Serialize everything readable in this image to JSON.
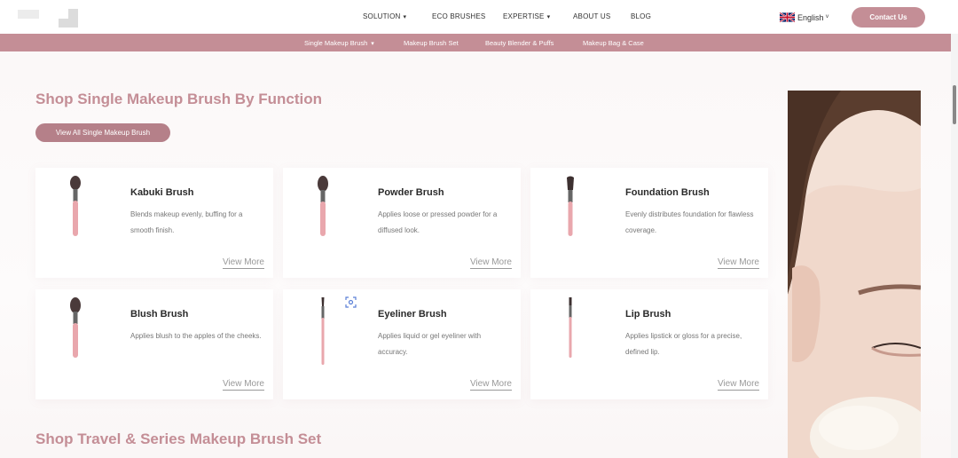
{
  "header": {
    "nav": [
      {
        "label": "SOLUTION",
        "dropdown": true
      },
      {
        "label": "ECO BRUSHES",
        "dropdown": false
      },
      {
        "label": "EXPERTISE",
        "dropdown": true
      },
      {
        "label": "ABOUT US",
        "dropdown": false
      },
      {
        "label": "BLOG",
        "dropdown": false
      }
    ],
    "language": "English",
    "contact_label": "Contact Us"
  },
  "subnav": [
    {
      "label": "Single Makeup Brush",
      "dropdown": true
    },
    {
      "label": "Makeup Brush Set"
    },
    {
      "label": "Beauty Blender & Puffs"
    },
    {
      "label": "Makeup Bag & Case"
    }
  ],
  "section1": {
    "title": "Shop Single Makeup Brush By Function",
    "view_all_label": "View All Single Makeup Brush",
    "cards": [
      {
        "title": "Kabuki Brush",
        "desc": "Blends makeup evenly, buffing for a smooth finish.",
        "more": "View More",
        "brush": "round"
      },
      {
        "title": "Powder Brush",
        "desc": "Applies loose or pressed powder for a diffused look.",
        "more": "View More",
        "brush": "round"
      },
      {
        "title": "Foundation Brush",
        "desc": "Evenly distributes foundation for flawless coverage.",
        "more": "View More",
        "brush": "flat"
      },
      {
        "title": "Blush Brush",
        "desc": "Applies blush to the apples of the cheeks.",
        "more": "View More",
        "brush": "round"
      },
      {
        "title": "Eyeliner Brush",
        "desc": "Applies liquid or gel eyeliner with accuracy.",
        "more": "View More",
        "brush": "thin"
      },
      {
        "title": "Lip Brush",
        "desc": "Applies lipstick or gloss for a precise, defined lip.",
        "more": "View More",
        "brush": "thin"
      }
    ]
  },
  "section2": {
    "title": "Shop Travel & Series Makeup Brush Set"
  },
  "colors": {
    "accent": "#c48e96",
    "button_dark": "#b58089"
  }
}
